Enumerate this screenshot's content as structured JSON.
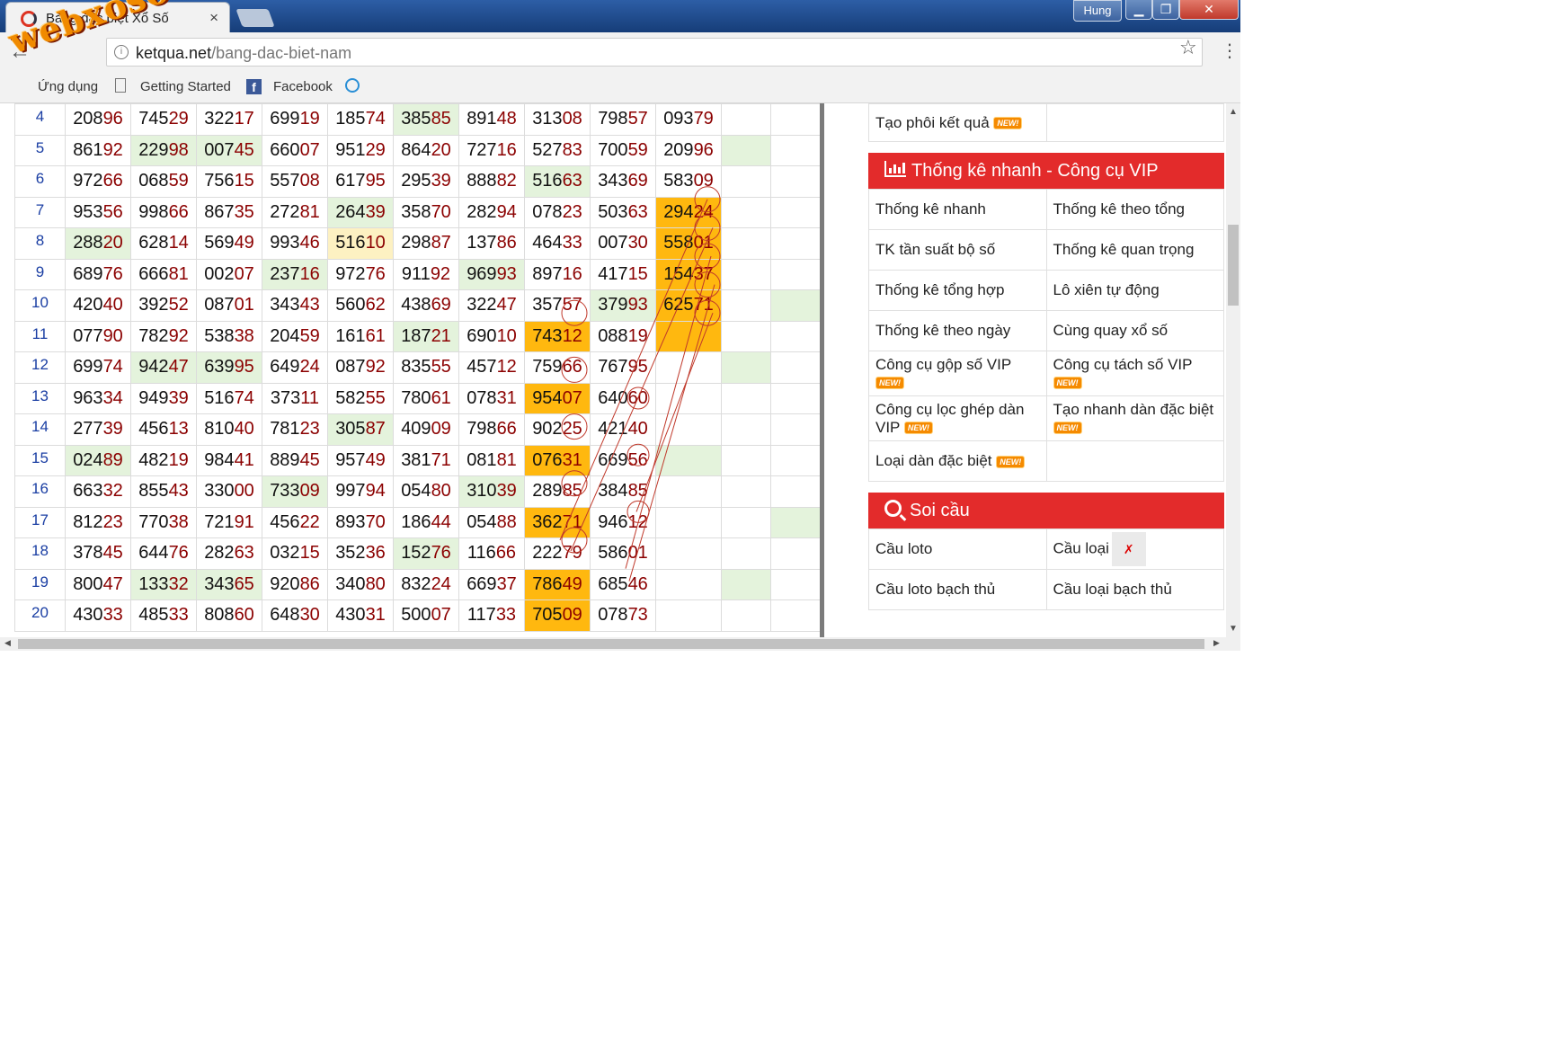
{
  "browser": {
    "tab_title": "Bảng đặc biệt Xổ Số",
    "tab_close": "×",
    "user_name": "Hung",
    "url_host": "ketqua.net",
    "url_path": "/bang-dac-biet-nam",
    "bookmarks": [
      "Ứng dụng",
      "Getting Started",
      "Facebook"
    ],
    "watermark": "webxoso.net"
  },
  "table": {
    "rows": [
      {
        "n": "4",
        "nums": [
          "20896",
          "74529",
          "32217",
          "69919",
          "18574",
          "38585",
          "89148",
          "31308",
          "79857",
          "09379"
        ],
        "hl": [
          "",
          "",
          "",
          "",
          "",
          "g",
          "",
          "",
          "",
          ""
        ],
        "e1": "",
        "e2": ""
      },
      {
        "n": "5",
        "nums": [
          "86192",
          "22998",
          "00745",
          "66007",
          "95129",
          "86420",
          "72716",
          "52783",
          "70059",
          "20996"
        ],
        "hl": [
          "",
          "g",
          "g",
          "",
          "",
          "",
          "",
          "",
          "",
          ""
        ],
        "e1": "g",
        "e2": ""
      },
      {
        "n": "6",
        "nums": [
          "97266",
          "06859",
          "75615",
          "55708",
          "61795",
          "29539",
          "88882",
          "51663",
          "34369",
          "58309"
        ],
        "hl": [
          "",
          "",
          "",
          "",
          "",
          "",
          "",
          "g",
          "",
          ""
        ],
        "e1": "",
        "e2": ""
      },
      {
        "n": "7",
        "nums": [
          "95356",
          "99866",
          "86735",
          "27281",
          "26439",
          "35870",
          "28294",
          "07823",
          "50363",
          "29424"
        ],
        "hl": [
          "",
          "",
          "",
          "",
          "g",
          "",
          "",
          "",
          "",
          "o"
        ],
        "e1": "",
        "e2": ""
      },
      {
        "n": "8",
        "nums": [
          "28820",
          "62814",
          "56949",
          "99346",
          "51610",
          "29887",
          "13786",
          "46433",
          "00730",
          "55801"
        ],
        "hl": [
          "g",
          "",
          "",
          "",
          "y",
          "",
          "",
          "",
          "",
          "o"
        ],
        "e1": "",
        "e2": ""
      },
      {
        "n": "9",
        "nums": [
          "68976",
          "66681",
          "00207",
          "23716",
          "97276",
          "91192",
          "96993",
          "89716",
          "41715",
          "15437"
        ],
        "hl": [
          "",
          "",
          "",
          "g",
          "",
          "",
          "g",
          "",
          "",
          "o"
        ],
        "e1": "",
        "e2": ""
      },
      {
        "n": "10",
        "nums": [
          "42040",
          "39252",
          "08701",
          "34343",
          "56062",
          "43869",
          "32247",
          "35757",
          "37993",
          "62571"
        ],
        "hl": [
          "",
          "",
          "",
          "",
          "",
          "",
          "",
          "",
          "g",
          "o"
        ],
        "e1": "",
        "e2": "g"
      },
      {
        "n": "11",
        "nums": [
          "07790",
          "78292",
          "53838",
          "20459",
          "16161",
          "18721",
          "69010",
          "74312",
          "08819",
          ""
        ],
        "hl": [
          "",
          "",
          "",
          "",
          "",
          "g",
          "",
          "o",
          "",
          "o"
        ],
        "e1": "",
        "e2": ""
      },
      {
        "n": "12",
        "nums": [
          "69974",
          "94247",
          "63995",
          "64924",
          "08792",
          "83555",
          "45712",
          "75966",
          "76795",
          ""
        ],
        "hl": [
          "",
          "g",
          "g",
          "",
          "",
          "",
          "",
          "",
          "",
          ""
        ],
        "e1": "g",
        "e2": ""
      },
      {
        "n": "13",
        "nums": [
          "96334",
          "94939",
          "51674",
          "37311",
          "58255",
          "78061",
          "07831",
          "95407",
          "64060",
          ""
        ],
        "hl": [
          "",
          "",
          "",
          "",
          "",
          "",
          "",
          "o",
          "",
          ""
        ],
        "e1": "",
        "e2": ""
      },
      {
        "n": "14",
        "nums": [
          "27739",
          "45613",
          "81040",
          "78123",
          "30587",
          "40909",
          "79866",
          "90225",
          "42140",
          ""
        ],
        "hl": [
          "",
          "",
          "",
          "",
          "g",
          "",
          "",
          "",
          "",
          ""
        ],
        "e1": "",
        "e2": ""
      },
      {
        "n": "15",
        "nums": [
          "02489",
          "48219",
          "98441",
          "88945",
          "95749",
          "38171",
          "08181",
          "07631",
          "66956",
          ""
        ],
        "hl": [
          "g",
          "",
          "",
          "",
          "",
          "",
          "",
          "o",
          "",
          "g"
        ],
        "e1": "",
        "e2": ""
      },
      {
        "n": "16",
        "nums": [
          "66332",
          "85543",
          "33000",
          "73309",
          "99794",
          "05480",
          "31039",
          "28985",
          "38485",
          ""
        ],
        "hl": [
          "",
          "",
          "",
          "g",
          "",
          "",
          "g",
          "",
          "",
          ""
        ],
        "e1": "",
        "e2": ""
      },
      {
        "n": "17",
        "nums": [
          "81223",
          "77038",
          "72191",
          "45622",
          "89370",
          "18644",
          "05488",
          "36271",
          "94612",
          ""
        ],
        "hl": [
          "",
          "",
          "",
          "",
          "",
          "",
          "",
          "o",
          "",
          ""
        ],
        "e1": "",
        "e2": "g"
      },
      {
        "n": "18",
        "nums": [
          "37845",
          "64476",
          "28263",
          "03215",
          "35236",
          "15276",
          "11666",
          "22279",
          "58601",
          ""
        ],
        "hl": [
          "",
          "",
          "",
          "",
          "",
          "g",
          "",
          "",
          "",
          ""
        ],
        "e1": "",
        "e2": ""
      },
      {
        "n": "19",
        "nums": [
          "80047",
          "13332",
          "34365",
          "92086",
          "34080",
          "83224",
          "66937",
          "78649",
          "68546",
          ""
        ],
        "hl": [
          "",
          "g",
          "g",
          "",
          "",
          "",
          "",
          "o",
          "",
          ""
        ],
        "e1": "g",
        "e2": ""
      },
      {
        "n": "20",
        "nums": [
          "43033",
          "48533",
          "80860",
          "64830",
          "43031",
          "50007",
          "11733",
          "70509",
          "07873",
          ""
        ],
        "hl": [
          "",
          "",
          "",
          "",
          "",
          "",
          "",
          "o",
          "",
          ""
        ],
        "e1": "",
        "e2": ""
      }
    ]
  },
  "sidebar": {
    "top_row": {
      "left": "Tạo phôi kết quả",
      "right": ""
    },
    "vip_title": "Thống kê nhanh - Công cụ VIP",
    "vip_rows": [
      {
        "left": "Thống kê nhanh",
        "left_new": false,
        "right": "Thống kê theo tổng",
        "right_new": false
      },
      {
        "left": "TK tần suất bộ số",
        "left_new": false,
        "right": "Thống kê quan trọng",
        "right_new": false
      },
      {
        "left": "Thống kê tổng hợp",
        "left_new": false,
        "right": "Lô xiên tự động",
        "right_new": false
      },
      {
        "left": "Thống kê theo ngày",
        "left_new": false,
        "right": "Cùng quay xổ số",
        "right_new": false
      },
      {
        "left": "Công cụ gộp số VIP",
        "left_new": true,
        "right": "Công cụ tách số VIP",
        "right_new": true
      },
      {
        "left": "Công cụ lọc ghép dàn VIP",
        "left_new": true,
        "right": "Tạo nhanh dàn đặc biệt",
        "right_new": true
      },
      {
        "left": "Loại dàn đặc biệt",
        "left_new": true,
        "right": "",
        "right_new": false
      }
    ],
    "soi_title": "Soi cầu",
    "soi_rows": [
      {
        "left": "Cầu loto",
        "right": "Cầu loại loto"
      },
      {
        "left": "Cầu loto bạch thủ",
        "right": "Cầu loại bạch thủ"
      }
    ],
    "new_badge": "NEW!"
  },
  "colors": {
    "highlight_green": "#e4f3dc",
    "highlight_orange": "#ffb80f",
    "highlight_yellow": "#fdf1c2",
    "header_red": "#e32b2b"
  }
}
